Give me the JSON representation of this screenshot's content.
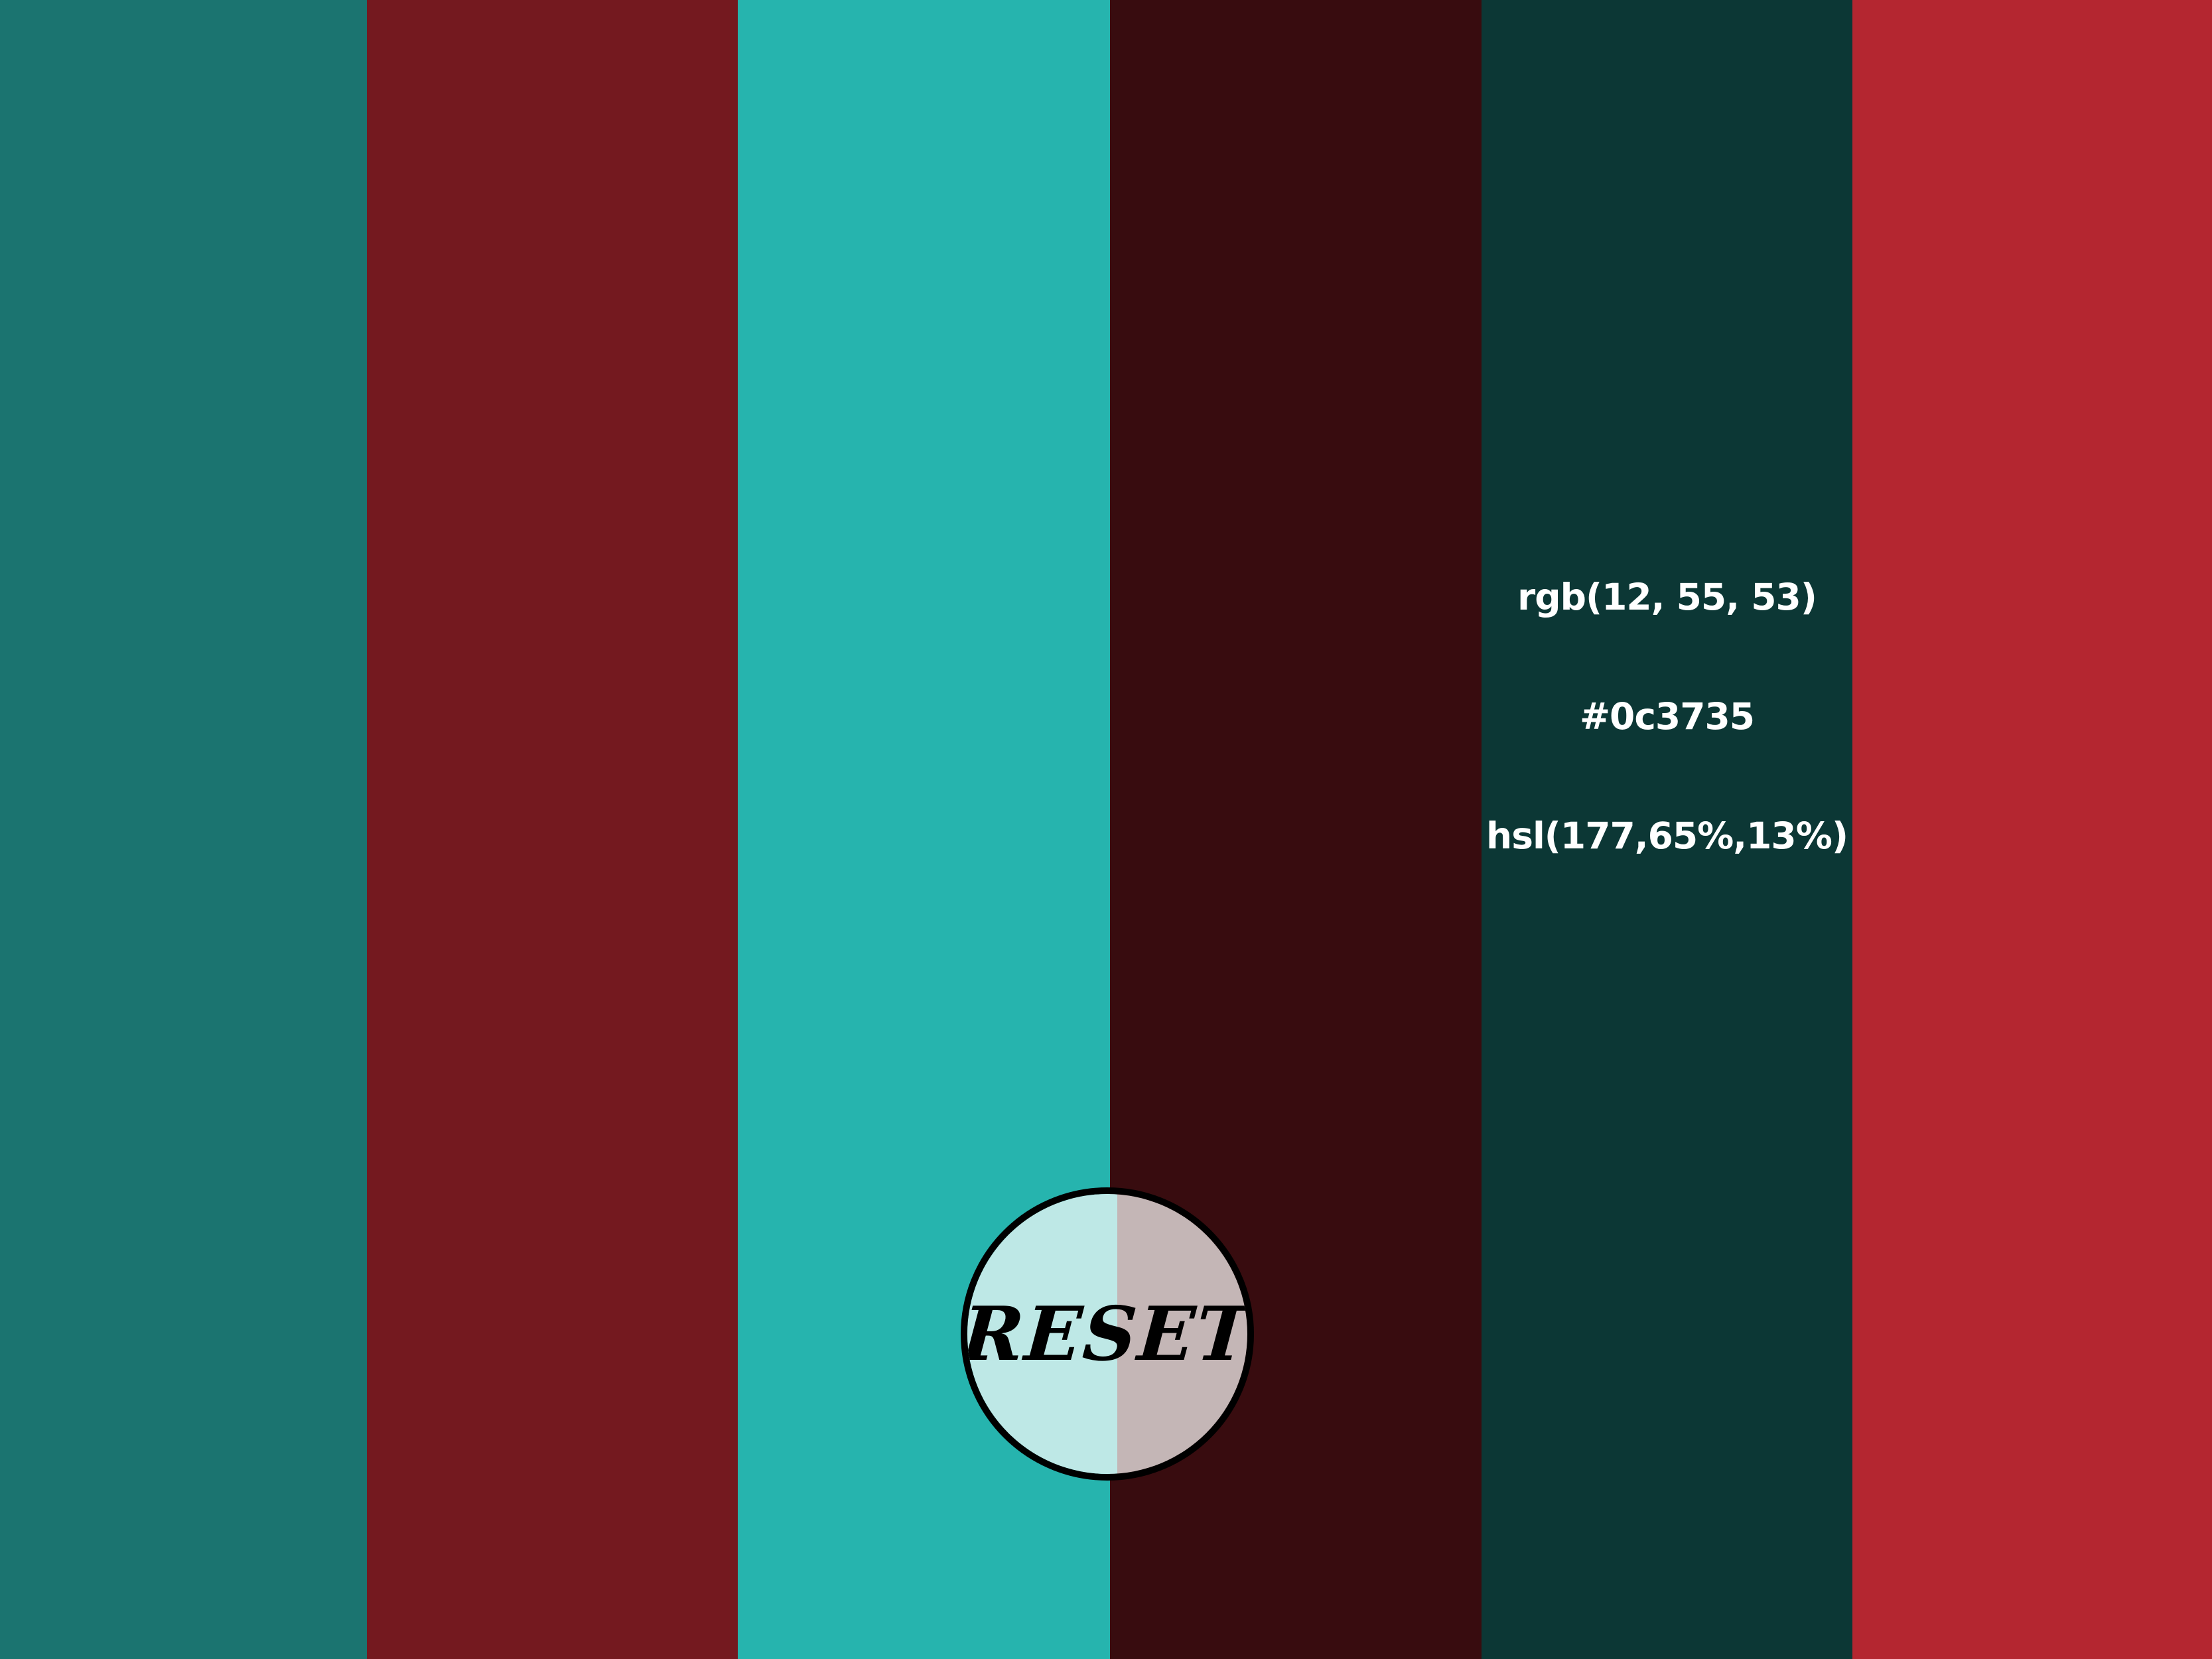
{
  "palette": {
    "stripes": [
      {
        "color": "#1b7470"
      },
      {
        "color": "#74191f"
      },
      {
        "color": "#26b4ae"
      },
      {
        "color": "#380c0f"
      },
      {
        "color": "#0c3735"
      },
      {
        "color": "#b42630"
      }
    ],
    "selected": {
      "rgb": "rgb(12, 55, 53)",
      "hex": "#0c3735",
      "hsl": "hsl(177,65%,13%)"
    }
  },
  "reset_button": {
    "label": "RESET",
    "left_color": "#bee8e6",
    "right_color": "#c4b6b6"
  }
}
